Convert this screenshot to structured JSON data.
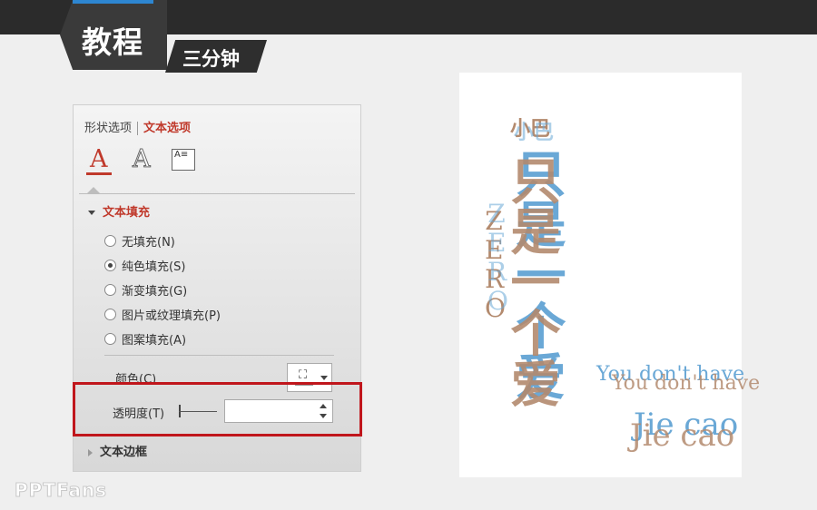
{
  "header": {
    "main_tag": "教程",
    "sub_tag": "三分钟"
  },
  "panel": {
    "tabs": {
      "shape": "形状选项",
      "text": "文本选项"
    },
    "icons": {
      "text_fill": "A",
      "text_outline": "A",
      "text_box": "A≡"
    },
    "text_fill": {
      "title": "文本填充",
      "options": [
        {
          "label": "无填充(N)",
          "checked": false
        },
        {
          "label": "纯色填充(S)",
          "checked": true
        },
        {
          "label": "渐变填充(G)",
          "checked": false
        },
        {
          "label": "图片或纹理填充(P)",
          "checked": false
        },
        {
          "label": "图案填充(A)",
          "checked": false
        }
      ],
      "color_label": "颜色(C)",
      "transparency_label": "透明度(T)",
      "transparency_value": ""
    },
    "text_border": {
      "title": "文本边框"
    }
  },
  "slide": {
    "xiaoba": "小巴",
    "vertical_chinese": [
      "只",
      "是",
      "一",
      "个",
      "爱"
    ],
    "vertical_english": [
      "Z",
      "E",
      "R",
      "O"
    ],
    "english_line": "You don't have",
    "jie_line": "Jie cao"
  },
  "watermark": "PPTFans",
  "colors": {
    "accent_red": "#c0392b",
    "highlight_red": "#c0161c",
    "banner_blue": "#2d86d1",
    "text_brown": "#b38a6e",
    "text_blue": "#6aa8d6"
  }
}
